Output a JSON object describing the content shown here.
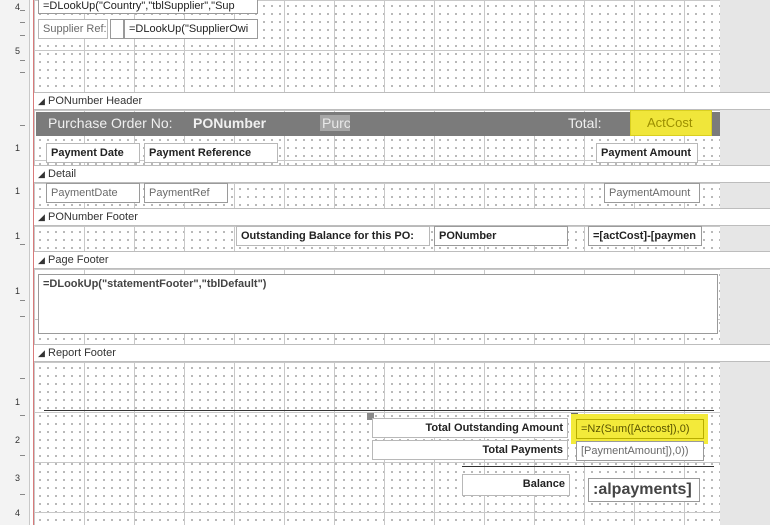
{
  "ruler": {
    "marks": [
      "4",
      "5",
      "1",
      "1",
      "1",
      "1",
      "1",
      "2",
      "3",
      "4"
    ]
  },
  "top_fields": {
    "country_expr": "=DLookUp(\"Country\",\"tblSupplier\",\"Sup",
    "supplier_ref_label": "Supplier Ref:",
    "supplier_owner_expr": "=DLookUp(\"SupplierOwi"
  },
  "sections": {
    "po_header": "PONumber Header",
    "detail": "Detail",
    "po_footer": "PONumber Footer",
    "page_footer": "Page Footer",
    "report_footer": "Report Footer"
  },
  "po_header": {
    "po_label": "Purchase Order No:",
    "po_value": "PONumber",
    "purc_field": "Purc",
    "total_label": "Total:",
    "act_cost": "ActCost",
    "col_payment_date": "Payment Date",
    "col_payment_ref": "Payment Reference",
    "col_payment_amount": "Payment Amount"
  },
  "detail": {
    "payment_date": "PaymentDate",
    "payment_ref": "PaymentRef",
    "payment_amount": "PaymentAmount"
  },
  "po_footer": {
    "outstanding_label": "Outstanding Balance for this PO:",
    "po_number": "PONumber",
    "outstanding_expr": "=[actCost]-[paymen"
  },
  "page_footer": {
    "statement_expr": "=DLookUp(\"statementFooter\",\"tblDefault\")"
  },
  "report_footer": {
    "total_outstanding_label": "Total Outstanding Amount",
    "total_outstanding_expr": "=Nz(Sum([Actcost]),0)",
    "total_payments_label": "Total Payments",
    "total_payments_expr": "[PaymentAmount]),0))",
    "balance_label": "Balance",
    "balance_expr": ":alpayments]"
  },
  "colors": {
    "po_bar": "#7b7b7b",
    "highlight": "#f3ea3a"
  }
}
